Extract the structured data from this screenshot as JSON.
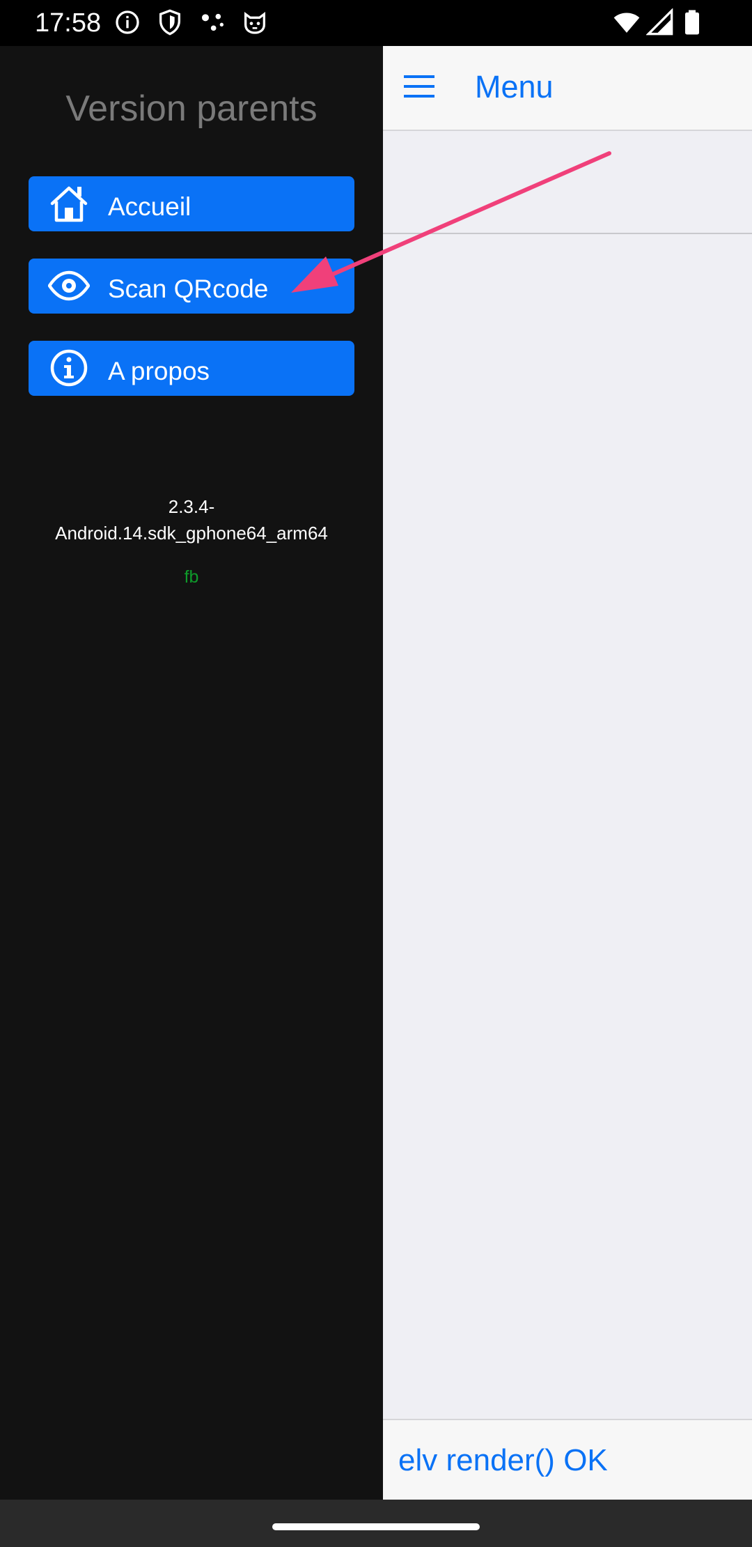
{
  "status_bar": {
    "time": "17:58",
    "icons": [
      "info-icon",
      "shield-icon",
      "network-dots-icon",
      "cat-face-icon",
      "wifi-icon",
      "signal-icon",
      "battery-icon"
    ]
  },
  "drawer": {
    "title": "Version parents",
    "items": [
      {
        "label": "Accueil",
        "icon": "home-icon"
      },
      {
        "label": "Scan QRcode",
        "icon": "eye-icon"
      },
      {
        "label": "A propos",
        "icon": "info-circle-icon"
      }
    ],
    "version_line1": "2.3.4-",
    "version_line2": "Android.14.sdk_gphone64_arm64",
    "fb": "fb"
  },
  "main": {
    "header_title": "Menu",
    "menu_icon": "hamburger-icon",
    "footer_text": "elv render() OK"
  },
  "annotation": {
    "arrow_color": "#f0407a"
  },
  "colors": {
    "accent": "#0a72f6",
    "drawer_bg": "#121212",
    "content_bg": "#efeff4",
    "fb_green": "#0e9a2a"
  }
}
